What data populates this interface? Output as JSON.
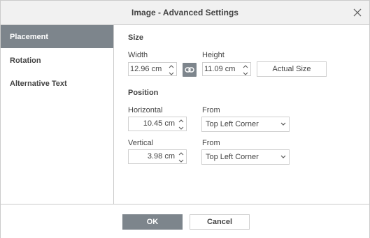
{
  "dialog": {
    "title": "Image - Advanced Settings",
    "close_icon": "close-icon"
  },
  "sidebar": {
    "items": [
      {
        "label": "Placement",
        "active": true
      },
      {
        "label": "Rotation",
        "active": false
      },
      {
        "label": "Alternative Text",
        "active": false
      }
    ]
  },
  "size": {
    "title": "Size",
    "width_label": "Width",
    "width_value": "12.96 cm",
    "height_label": "Height",
    "height_value": "11.09 cm",
    "constrain_icon": "link-icon",
    "actual_size_label": "Actual Size"
  },
  "position": {
    "title": "Position",
    "horizontal_label": "Horizontal",
    "horizontal_value": "10.45 cm",
    "horizontal_from_label": "From",
    "horizontal_from_value": "Top Left Corner",
    "vertical_label": "Vertical",
    "vertical_value": "3.98 cm",
    "vertical_from_label": "From",
    "vertical_from_value": "Top Left Corner"
  },
  "footer": {
    "ok_label": "OK",
    "cancel_label": "Cancel"
  },
  "colors": {
    "accent": "#7d858c",
    "border": "#cbcbcb",
    "titlebar": "#f1f1f1",
    "text": "#444444"
  }
}
